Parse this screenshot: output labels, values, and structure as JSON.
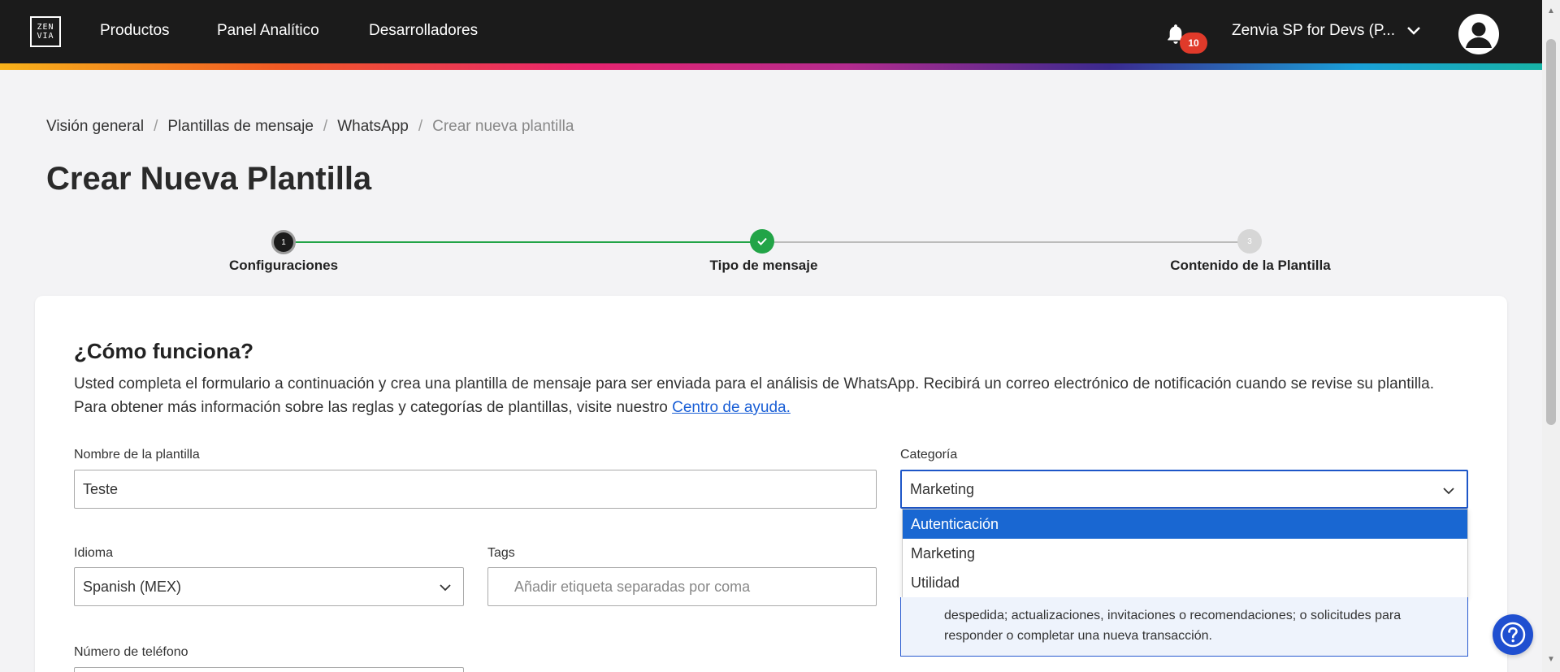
{
  "header": {
    "logo_text": "ZEN\nVIA",
    "nav": [
      "Productos",
      "Panel Analítico",
      "Desarrolladores"
    ],
    "notification_count": "10",
    "account_name": "Zenvia SP for Devs (P..."
  },
  "breadcrumb": {
    "items": [
      "Visión general",
      "Plantillas de mensaje",
      "WhatsApp"
    ],
    "current": "Crear nueva plantilla",
    "separator": "/"
  },
  "page_title": "Crear Nueva Plantilla",
  "stepper": {
    "steps": [
      {
        "label": "Configuraciones",
        "number": "1",
        "state": "current"
      },
      {
        "label": "Tipo de mensaje",
        "number": "2",
        "state": "done"
      },
      {
        "label": "Contenido de la Plantilla",
        "number": "3",
        "state": "pending"
      }
    ]
  },
  "how_it_works": {
    "title": "¿Cómo funciona?",
    "text_line1": "Usted completa el formulario a continuación y crea una plantilla de mensaje para ser enviada para el análisis de WhatsApp. Recibirá un correo electrónico de notificación cuando se revise su plantilla.",
    "text_line2": "Para obtener más información sobre las reglas y categorías de plantillas, visite nuestro ",
    "help_link": "Centro de ayuda."
  },
  "form": {
    "template_name_label": "Nombre de la plantilla",
    "template_name_value": "Teste",
    "category_label": "Categoría",
    "category_value": "Marketing",
    "category_options": [
      "Autenticación",
      "Marketing",
      "Utilidad"
    ],
    "category_highlighted": "Autenticación",
    "language_label": "Idioma",
    "language_value": "Spanish (MEX)",
    "tags_label": "Tags",
    "tags_placeholder": "Añadir etiqueta separadas por coma",
    "phone_label": "Número de teléfono"
  },
  "info_box": {
    "line1": "despedida; actualizaciones, invitaciones o recomendaciones; o solicitudes para",
    "line2": "responder o completar una nueva transacción."
  },
  "colors": {
    "accent_blue": "#1967d2",
    "step_green": "#22a447",
    "topbar": "#1b1b1b"
  }
}
